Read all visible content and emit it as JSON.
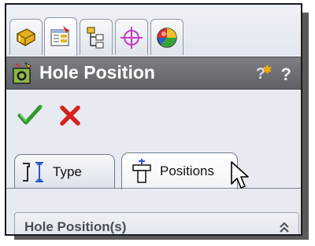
{
  "icon_tabs": [
    {
      "icon": "feature-manager-icon",
      "active": false
    },
    {
      "icon": "property-manager-icon",
      "active": true
    },
    {
      "icon": "configuration-manager-icon",
      "active": false
    },
    {
      "icon": "dimxpert-manager-icon",
      "active": false
    },
    {
      "icon": "display-manager-icon",
      "active": false
    }
  ],
  "property_manager": {
    "title": "Hole Position",
    "help_icon": "detailed-preview-help-icon",
    "help2_icon": "help-icon"
  },
  "actions": {
    "ok_icon": "checkmark-icon",
    "cancel_icon": "close-icon",
    "ok_color": "#2f9a2a",
    "cancel_color": "#d6221c"
  },
  "tabs": {
    "type_label": "Type",
    "positions_label": "Positions",
    "active": "Positions"
  },
  "group": {
    "title": "Hole Position(s)",
    "collapse_icon": "double-chevron-up-icon"
  }
}
